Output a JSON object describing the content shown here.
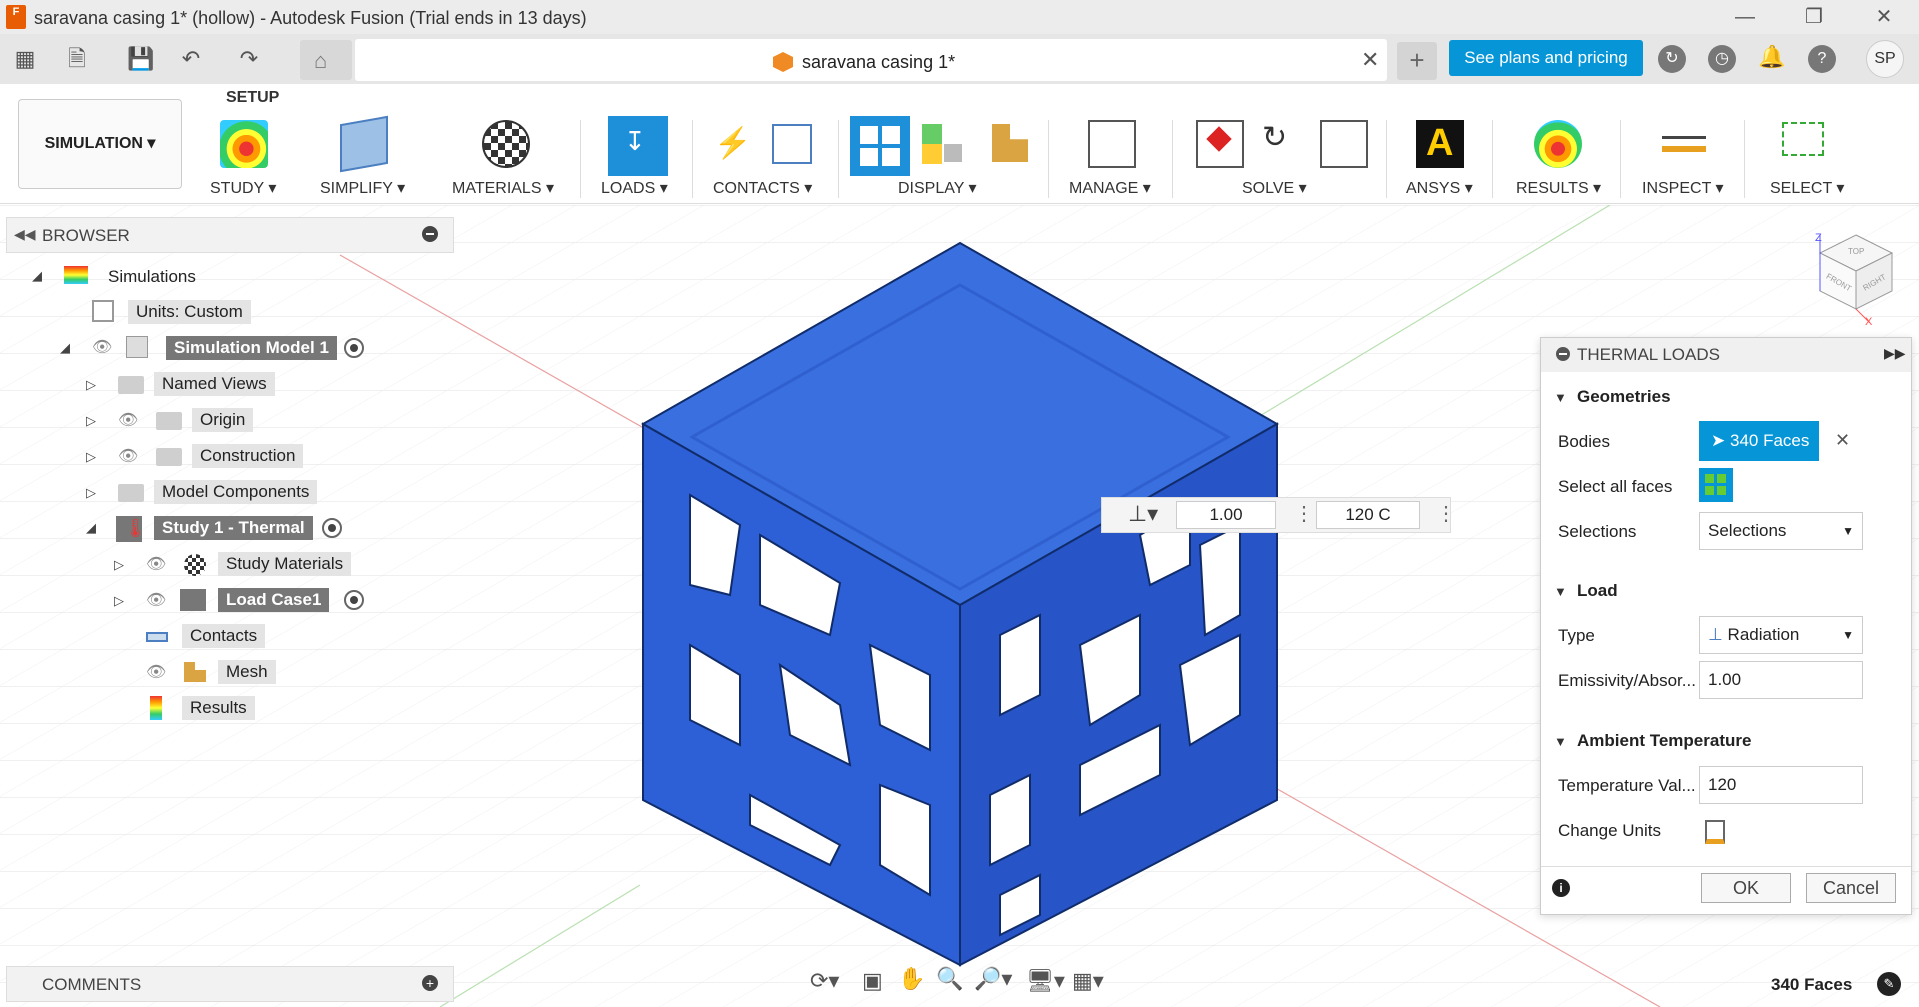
{
  "window": {
    "title": "saravana casing 1* (hollow) - Autodesk Fusion (Trial ends in 13 days)",
    "logo": "F"
  },
  "tabbar": {
    "doc_tab_title": "saravana casing 1*",
    "plans_button": "See plans and pricing",
    "avatar_initials": "SP"
  },
  "toolbar": {
    "workspace": "SIMULATION",
    "setup_label": "SETUP",
    "groups": [
      "STUDY",
      "SIMPLIFY",
      "MATERIALS",
      "LOADS",
      "CONTACTS",
      "DISPLAY",
      "MANAGE",
      "SOLVE",
      "ANSYS",
      "RESULTS",
      "INSPECT",
      "SELECT"
    ]
  },
  "browser": {
    "title": "BROWSER",
    "items": [
      "Simulations",
      "Units: Custom",
      "Simulation Model 1",
      "Named Views",
      "Origin",
      "Construction",
      "Model Components",
      "Study 1 - Thermal",
      "Study Materials",
      "Load Case1",
      "Contacts",
      "Mesh",
      "Results"
    ]
  },
  "comments": {
    "title": "COMMENTS"
  },
  "float_input": {
    "value1": "1.00",
    "value2": "120 C"
  },
  "thermal_loads": {
    "title": "THERMAL LOADS",
    "geometries": {
      "section": "Geometries",
      "bodies_label": "Bodies",
      "bodies_value": "340 Faces",
      "select_all_label": "Select all faces",
      "selections_label": "Selections",
      "selections_value": "Selections"
    },
    "load": {
      "section": "Load",
      "type_label": "Type",
      "type_value": "Radiation",
      "emissivity_label": "Emissivity/Absor...",
      "emissivity_value": "1.00"
    },
    "ambient": {
      "section": "Ambient Temperature",
      "temp_label": "Temperature Val...",
      "temp_value": "120",
      "units_label": "Change Units"
    },
    "ok": "OK",
    "cancel": "Cancel"
  },
  "viewcube": {
    "top": "TOP",
    "front": "FRONT",
    "right": "RIGHT",
    "axis_z": "Z",
    "axis_x": "X"
  },
  "status": {
    "selection": "340 Faces"
  },
  "colors": {
    "accent": "#0696d7",
    "model": "#2d5fd6",
    "dialog_blue": "#0696d7"
  }
}
